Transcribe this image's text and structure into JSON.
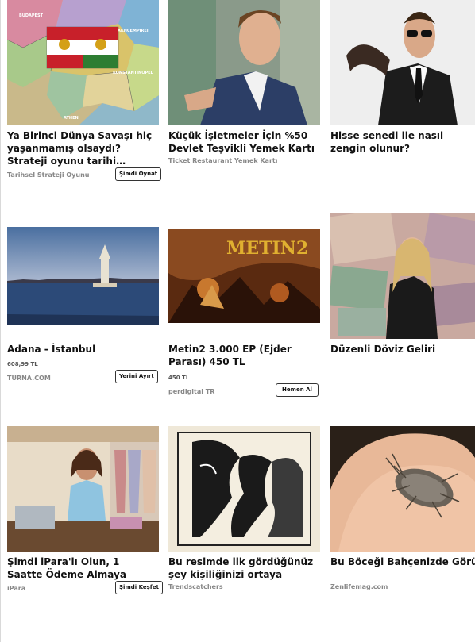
{
  "cards": [
    {
      "title": "Ya Birinci Dünya Savaşı hiç yaşanmamış olsaydı? Strateji oyunu tarihi senaryoları simüle...",
      "source": "Tarihsel Strateji Oyunu",
      "cta": "Şimdi Oynat",
      "map_labels": [
        "BUDAPEST",
        "AKHCEMPIREI",
        "KONSTANTINOPEL",
        "ATHEN"
      ]
    },
    {
      "title": "Küçük İşletmeler İçin %50 Devlet Teşvikli Yemek Kartı",
      "source": "Ticket Restaurant Yemek Kartı"
    },
    {
      "title": "Hisse senedi ile nasıl zengin olunur?"
    },
    {
      "title": "Adana - İstanbul",
      "price": "608,99 TL",
      "source": "TURNA.COM",
      "cta": "Yerini Ayırt"
    },
    {
      "title": "Metin2 3.000 EP (Ejder Parası) 450 TL",
      "price": "450 TL",
      "source": "perdigital TR",
      "cta": "Hemen Al",
      "logo": "METIN2"
    },
    {
      "title": "Düzenli Döviz Geliri Sağlıyor!"
    },
    {
      "title": "Şimdi iPara'lı Olun, 1 Saatte Ödeme Almaya Başlayın",
      "source": "iPara",
      "cta": "Şimdi Keşfet"
    },
    {
      "title": "Bu resimde ilk gördüğünüz şey kişiliğinizi ortaya koyuyor",
      "source": "Trendscatchers"
    },
    {
      "title": "Bu Böceği Bahçenizde Görürseniz Hemen Yapın",
      "source": "Zenlifemag.com"
    }
  ],
  "colors": {
    "title": "#111111",
    "source": "#888888",
    "border": "#333333"
  }
}
